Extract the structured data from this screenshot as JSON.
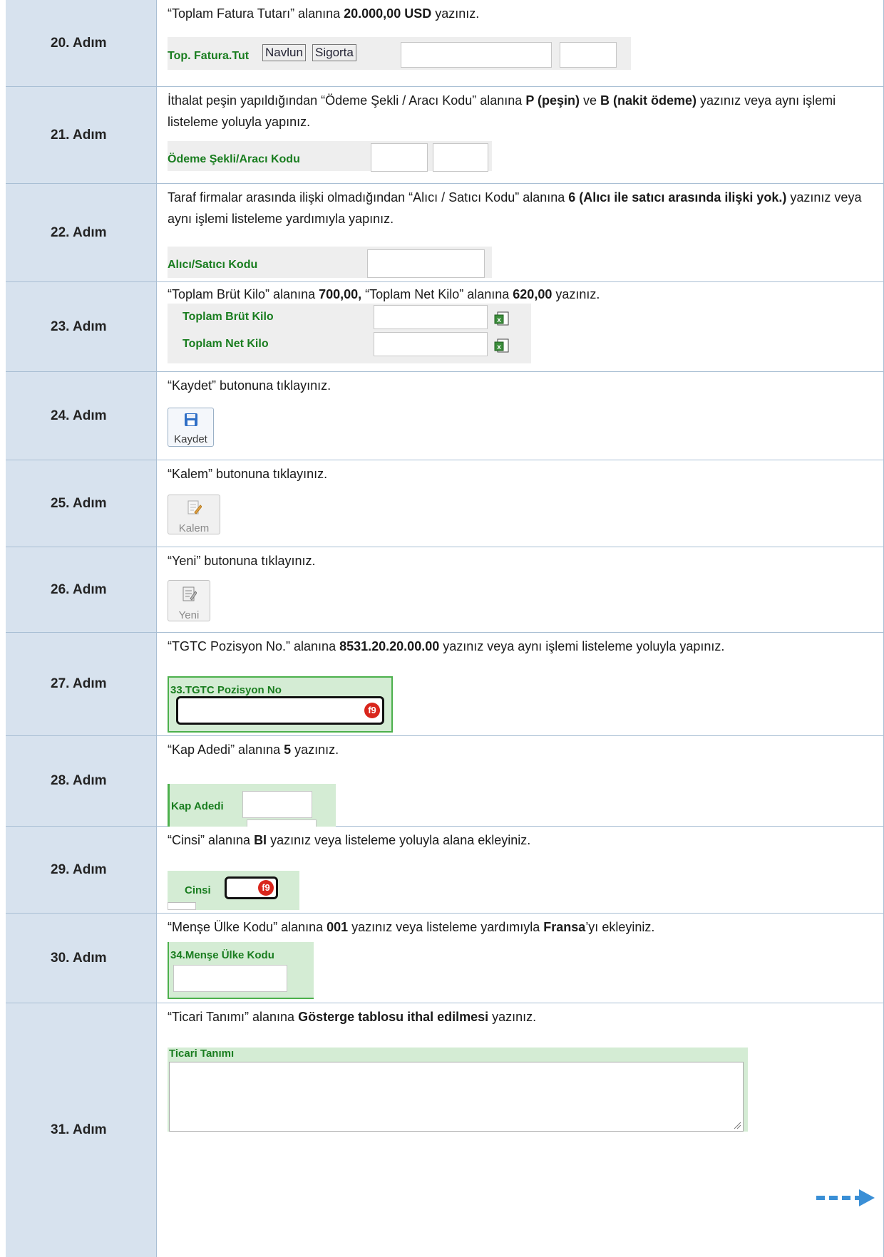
{
  "steps": [
    {
      "id": "20",
      "label": "20. Adım",
      "text": [
        "“Toplam Fatura Tutarı” alanına ",
        "20.000,00 USD",
        " yazınız."
      ],
      "snip": {
        "label": "Top. Fatura.Tut",
        "btn1": "Navlun",
        "btn2": "Sigorta"
      }
    },
    {
      "id": "21",
      "label": "21. Adım",
      "text": [
        "İthalat peşin yapıldığından “Ödeme Şekli / Aracı Kodu” alanına ",
        "P (peşin)",
        " ve ",
        "B (nakit ödeme)",
        " yazınız veya aynı işlemi listeleme yoluyla yapınız."
      ],
      "snip": {
        "label": "Ödeme Şekli/Aracı Kodu"
      }
    },
    {
      "id": "22",
      "label": "22. Adım",
      "text": [
        "Taraf firmalar arasında ilişki olmadığından “Alıcı / Satıcı Kodu” alanına ",
        "6 (Alıcı ile satıcı arasında ilişki yok.)",
        " yazınız veya aynı işlemi listeleme yardımıyla yapınız."
      ],
      "snip": {
        "label": "Alıcı/Satıcı Kodu"
      }
    },
    {
      "id": "23",
      "label": "23. Adım",
      "text": [
        "“Toplam Brüt Kilo” alanına ",
        "700,00,",
        " “Toplam Net Kilo” alanına ",
        "620,00",
        " yazınız."
      ],
      "snip": {
        "label1": "Toplam Brüt Kilo",
        "label2": "Toplam Net Kilo"
      }
    },
    {
      "id": "24",
      "label": "24. Adım",
      "text": [
        "“Kaydet” butonuna tıklayınız."
      ],
      "snip": {
        "btn": "Kaydet"
      }
    },
    {
      "id": "25",
      "label": "25. Adım",
      "text": [
        "“Kalem” butonuna tıklayınız."
      ],
      "snip": {
        "btn": "Kalem"
      }
    },
    {
      "id": "26",
      "label": "26. Adım",
      "text": [
        "“Yeni” butonuna tıklayınız."
      ],
      "snip": {
        "btn": "Yeni"
      }
    },
    {
      "id": "27",
      "label": "27. Adım",
      "text": [
        "“TGTC Pozisyon No.” alanına ",
        "8531.20.20.00.00",
        " yazınız veya aynı işlemi listeleme yoluyla yapınız."
      ],
      "snip": {
        "label": "33.TGTC Pozisyon No",
        "key": "f9"
      }
    },
    {
      "id": "28",
      "label": "28. Adım",
      "text": [
        "“Kap Adedi” alanına ",
        "5",
        " yazınız."
      ],
      "snip": {
        "label": "Kap Adedi"
      }
    },
    {
      "id": "29",
      "label": "29. Adım",
      "text": [
        "“Cinsi” alanına ",
        "BI",
        " yazınız veya listeleme yoluyla  alana ekleyiniz."
      ],
      "snip": {
        "label": "Cinsi",
        "key": "f9"
      }
    },
    {
      "id": "30",
      "label": "30. Adım",
      "text": [
        "“Menşe Ülke Kodu” alanına ",
        "001",
        " yazınız veya listeleme yardımıyla ",
        "Fransa",
        "’yı ekleyiniz."
      ],
      "snip": {
        "label": "34.Menşe Ülke Kodu"
      }
    },
    {
      "id": "31",
      "label": "31. Adım",
      "text": [
        "“Ticari Tanımı” alanına ",
        "Gösterge tablosu ithal edilmesi",
        " yazınız."
      ],
      "snip": {
        "label": "Ticari Tanımı"
      }
    }
  ],
  "colors": {
    "step_bg": "#d7e2ee",
    "green_label": "#197d1f",
    "arrow": "#3a8fd6"
  },
  "icons": {
    "excel": "excel-icon",
    "save": "floppy-disk-icon",
    "edit": "edit-document-icon",
    "arrow": "dashed-arrow-right-icon"
  }
}
